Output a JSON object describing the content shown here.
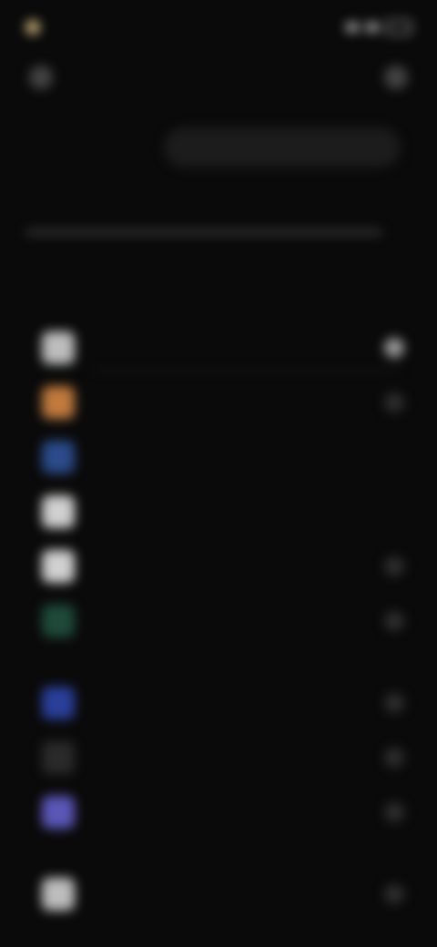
{
  "status": {
    "time": "",
    "signal": "signal-icon",
    "wifi": "wifi-icon",
    "battery": "battery-icon"
  },
  "header": {
    "back_icon": "back-icon",
    "menu_icon": "menu-icon"
  },
  "search": {
    "placeholder": ""
  },
  "brand": "",
  "subtitle": "",
  "sections": [
    {
      "title": ""
    },
    {
      "title": ""
    },
    {
      "title": ""
    }
  ],
  "items": [
    {
      "label": "",
      "color": "#bdbdbd"
    },
    {
      "label": "",
      "color": "#c07a3e"
    },
    {
      "label": "",
      "color": "#2b4b8a"
    },
    {
      "label": "",
      "color": "#d0d0d0"
    },
    {
      "label": "",
      "color": "#d0d0d0"
    },
    {
      "label": "",
      "color": "#1f4a3a"
    },
    {
      "label": "",
      "color": "#2a3f9a"
    },
    {
      "label": "",
      "color": "#2a2a2a"
    },
    {
      "label": "",
      "color": "#5b57b8"
    },
    {
      "label": "",
      "color": "#bdbdbd"
    }
  ]
}
